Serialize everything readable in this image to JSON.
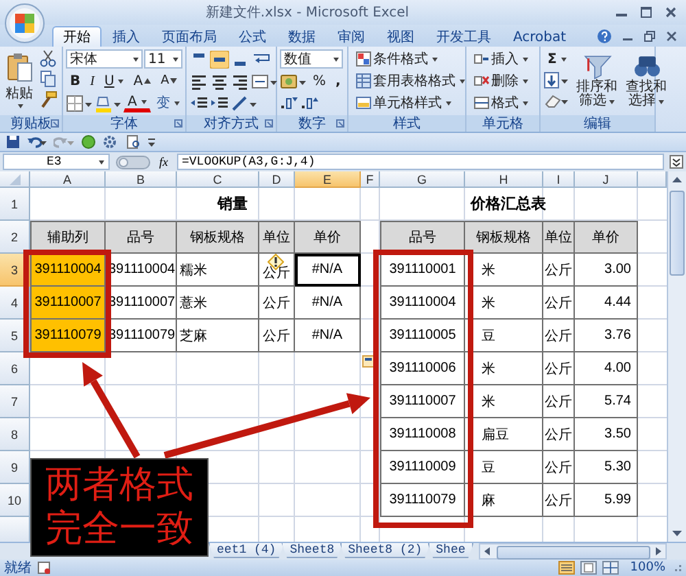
{
  "window": {
    "title": "新建文件.xlsx - Microsoft Excel"
  },
  "tabs": [
    {
      "label": "开始",
      "selected": true
    },
    {
      "label": "插入",
      "selected": false
    },
    {
      "label": "页面布局",
      "selected": false
    },
    {
      "label": "公式",
      "selected": false
    },
    {
      "label": "数据",
      "selected": false
    },
    {
      "label": "审阅",
      "selected": false
    },
    {
      "label": "视图",
      "selected": false
    },
    {
      "label": "开发工具",
      "selected": false
    },
    {
      "label": "Acrobat",
      "selected": false
    }
  ],
  "ribbon": {
    "clipboard": {
      "title": "剪贴板",
      "paste": "粘贴"
    },
    "font": {
      "title": "字体",
      "name": "宋体",
      "size": "11",
      "bold": "B",
      "italic": "I",
      "underline": "U",
      "grow": "A",
      "shrink": "A",
      "font_color": "A",
      "phonetic": "变"
    },
    "alignment": {
      "title": "对齐方式",
      "vertical_align": [
        {
          "selected": false
        },
        {
          "selected": true
        },
        {
          "selected": false
        }
      ]
    },
    "number": {
      "title": "数字",
      "format": "数值",
      "percent": "%",
      "comma": ","
    },
    "styles": {
      "title": "样式",
      "items": [
        "条件格式",
        "套用表格格式",
        "单元格样式"
      ]
    },
    "cells": {
      "title": "单元格",
      "items": [
        "插入",
        "删除",
        "格式"
      ]
    },
    "editing": {
      "title": "编辑",
      "sum": "Σ",
      "buttons": [
        "排序和筛选",
        "查找和选择"
      ]
    }
  },
  "formula_bar": {
    "name_box": "E3",
    "fx": "fx",
    "formula": "=VLOOKUP(A3,G:J,4)"
  },
  "sheet": {
    "columns": [
      {
        "label": "A",
        "selected": false
      },
      {
        "label": "B",
        "selected": false
      },
      {
        "label": "C",
        "selected": false
      },
      {
        "label": "D",
        "selected": false
      },
      {
        "label": "E",
        "selected": true
      },
      {
        "label": "F",
        "selected": false
      },
      {
        "label": "G",
        "selected": false
      },
      {
        "label": "H",
        "selected": false
      },
      {
        "label": "I",
        "selected": false
      },
      {
        "label": "J",
        "selected": false
      }
    ],
    "rows": [
      {
        "label": "1",
        "selected": false
      },
      {
        "label": "2",
        "selected": false
      },
      {
        "label": "3",
        "selected": true
      },
      {
        "label": "4",
        "selected": false
      },
      {
        "label": "5",
        "selected": false
      },
      {
        "label": "6",
        "selected": false
      },
      {
        "label": "7",
        "selected": false
      },
      {
        "label": "8",
        "selected": false
      },
      {
        "label": "9",
        "selected": false
      },
      {
        "label": "10",
        "selected": false
      }
    ],
    "sales_table": {
      "title": "销量",
      "columns": [
        "辅助列",
        "品号",
        "钢板规格",
        "单位",
        "单价"
      ],
      "rows": [
        [
          "391110004",
          "391110004",
          "糯米",
          "公斤",
          "#N/A"
        ],
        [
          "391110007",
          "391110007",
          "薏米",
          "公斤",
          "#N/A"
        ],
        [
          "391110079",
          "391110079",
          "芝麻",
          "公斤",
          "#N/A"
        ]
      ]
    },
    "price_table": {
      "title": "价格汇总表",
      "columns": [
        "品号",
        "钢板规格",
        "单位",
        "单价"
      ],
      "rows": [
        [
          "391110001",
          "米",
          "公斤",
          "3.00"
        ],
        [
          "391110004",
          "米",
          "公斤",
          "4.44"
        ],
        [
          "391110005",
          "豆",
          "公斤",
          "3.76"
        ],
        [
          "391110006",
          "米",
          "公斤",
          "4.00"
        ],
        [
          "391110007",
          "米",
          "公斤",
          "5.74"
        ],
        [
          "391110008",
          "扁豆",
          "公斤",
          "3.50"
        ],
        [
          "391110009",
          "豆",
          "公斤",
          "5.30"
        ],
        [
          "391110079",
          "麻",
          "公斤",
          "5.99"
        ]
      ]
    }
  },
  "sheet_tabs": [
    "eet1 (4)",
    "Sheet8",
    "Sheet8 (2)",
    "Shee"
  ],
  "status_bar": {
    "status": "就绪",
    "zoom": "100%"
  },
  "annotation": {
    "note": "两者格式完全一致"
  }
}
